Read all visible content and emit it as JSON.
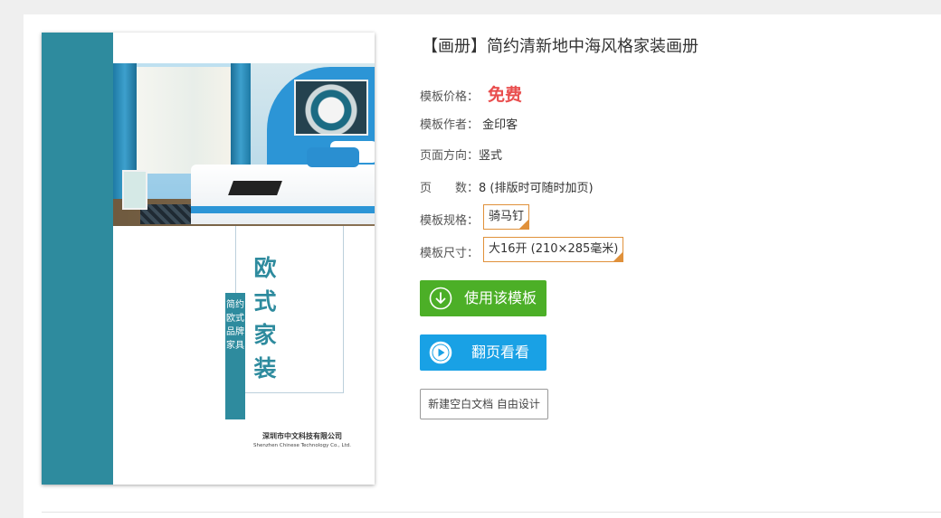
{
  "product": {
    "title": "【画册】简约清新地中海风格家装画册",
    "price_label": "模板价格：",
    "price_value": "免费",
    "author_label": "模板作者：",
    "author_value": "金印客",
    "orientation_label": "页面方向：",
    "orientation_value": "竖式",
    "pages_label": "页　　数：",
    "pages_value": "8 (排版时可随时加页)",
    "spec_label": "模板规格：",
    "spec_value": "骑马钉",
    "size_label": "模板尺寸：",
    "size_value": "大16开 (210×285毫米)"
  },
  "actions": {
    "use_template": "使用该模板",
    "flip_view": "翻页看看",
    "new_blank": "新建空白文档 自由设计"
  },
  "cover": {
    "main_title": "欧式家装",
    "subtitle": "简约欧式品牌家具",
    "company_cn": "深圳市中文科技有限公司",
    "company_en": "Shenzhen Chinese Technology Co., Ltd."
  },
  "colors": {
    "accent_teal": "#2e8b9e",
    "price_red": "#e94e4e",
    "button_green": "#4caf27",
    "button_blue": "#19a1e5",
    "tag_border": "#e0913b"
  },
  "icons": {
    "use_template": "download-circle-icon",
    "flip_view": "play-circle-icon",
    "tag_corner": "check-corner-icon"
  }
}
